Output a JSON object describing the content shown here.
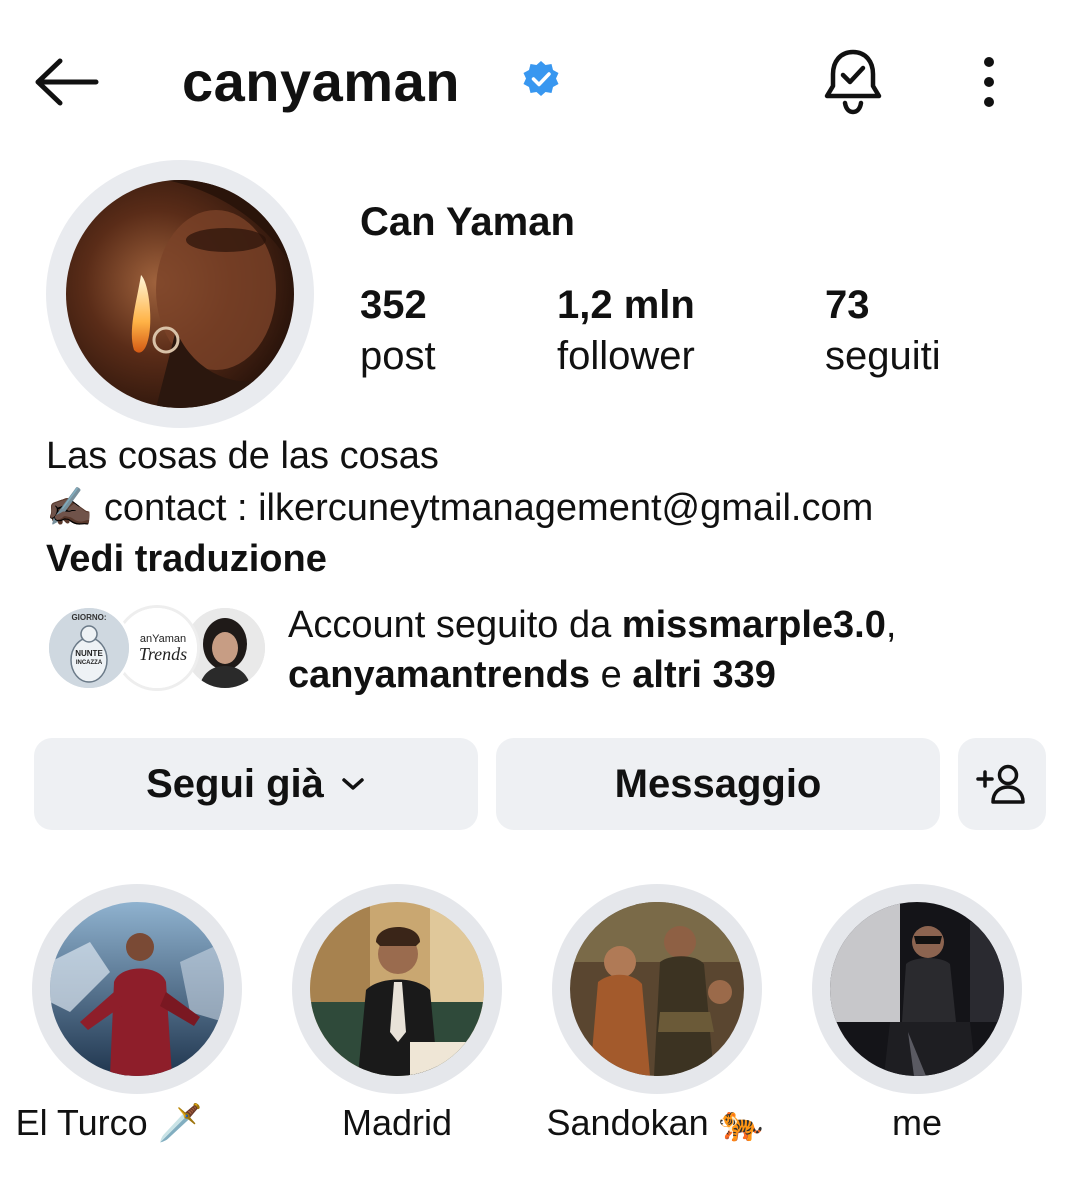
{
  "header": {
    "username": "canyaman",
    "verified_color": "#3897f0"
  },
  "profile": {
    "display_name": "Can Yaman",
    "stats": [
      {
        "value": "352",
        "label": "post"
      },
      {
        "value": "1,2 mln",
        "label": "follower"
      },
      {
        "value": "73",
        "label": "seguiti"
      }
    ]
  },
  "bio": {
    "line1": "Las cosas de las cosas",
    "line2_emoji": "✍🏿",
    "line2": "contact : ilkercuneytmanagement@gmail.com",
    "translate": "Vedi traduzione"
  },
  "mutual": {
    "prefix": "Account seguito da ",
    "name1": "missmarple3.0",
    "comma": ",",
    "name2": "canyamantrends",
    "and": " e ",
    "others": "altri 339",
    "avatar2_text1": "anYaman",
    "avatar2_text2": "Trends",
    "avatar1_text1": "GIORNO:",
    "avatar1_text2": "NUNTE",
    "avatar1_text3": "INCAZZA"
  },
  "actions": {
    "follow": "Segui già",
    "message": "Messaggio"
  },
  "highlights": [
    {
      "label": "El Turco 🗡️"
    },
    {
      "label": "Madrid"
    },
    {
      "label": "Sandokan 🐅"
    },
    {
      "label": "me"
    }
  ]
}
